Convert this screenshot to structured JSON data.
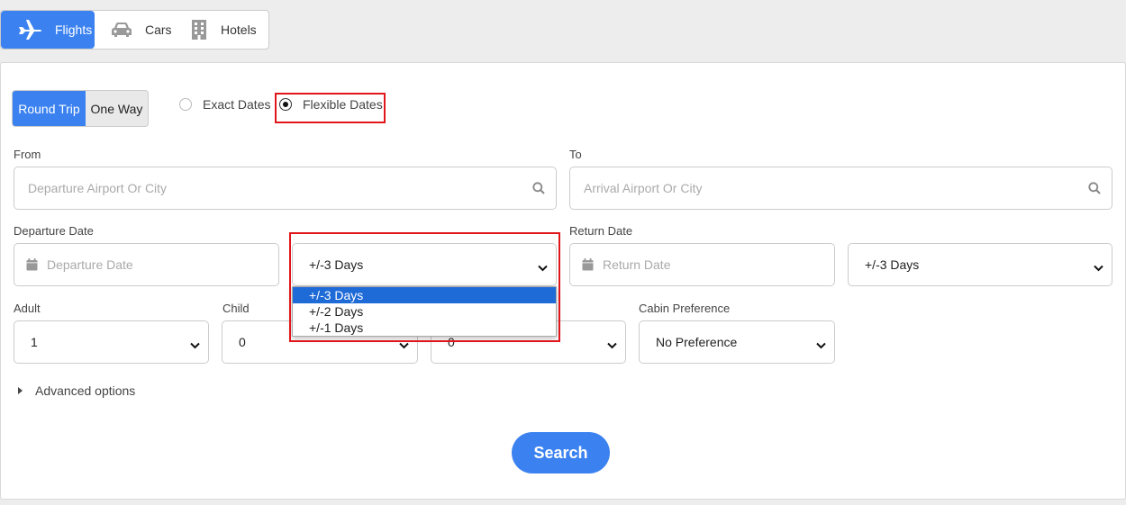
{
  "tabs": [
    {
      "label": "Flights",
      "icon": "plane-icon",
      "active": true
    },
    {
      "label": "Cars",
      "icon": "car-icon",
      "active": false
    },
    {
      "label": "Hotels",
      "icon": "hotel-icon",
      "active": false
    }
  ],
  "trip_type": {
    "round_trip": "Round Trip",
    "one_way": "One Way",
    "selected": "Round Trip"
  },
  "date_mode": {
    "exact": "Exact Dates",
    "flexible": "Flexible Dates",
    "selected": "Flexible Dates"
  },
  "from": {
    "label": "From",
    "placeholder": "Departure Airport Or City"
  },
  "to": {
    "label": "To",
    "placeholder": "Arrival Airport Or City"
  },
  "departure": {
    "label": "Departure Date",
    "placeholder": "Departure Date",
    "flex_value": "+/-3 Days"
  },
  "return": {
    "label": "Return Date",
    "placeholder": "Return Date",
    "flex_value": "+/-3 Days"
  },
  "flex_dropdown": {
    "options": [
      "+/-3 Days",
      "+/-2 Days",
      "+/-1 Days"
    ],
    "selected_index": 0
  },
  "passengers": {
    "adult_label": "Adult",
    "adult_value": "1",
    "child_label": "Child",
    "child_value": "0",
    "infant_value": "0",
    "cabin_label": "Cabin Preference",
    "cabin_value": "No Preference"
  },
  "advanced": "Advanced options",
  "search_button": "Search",
  "colors": {
    "accent": "#3b82f0",
    "highlight": "#e0161b",
    "option_selected": "#1e6ad6"
  }
}
